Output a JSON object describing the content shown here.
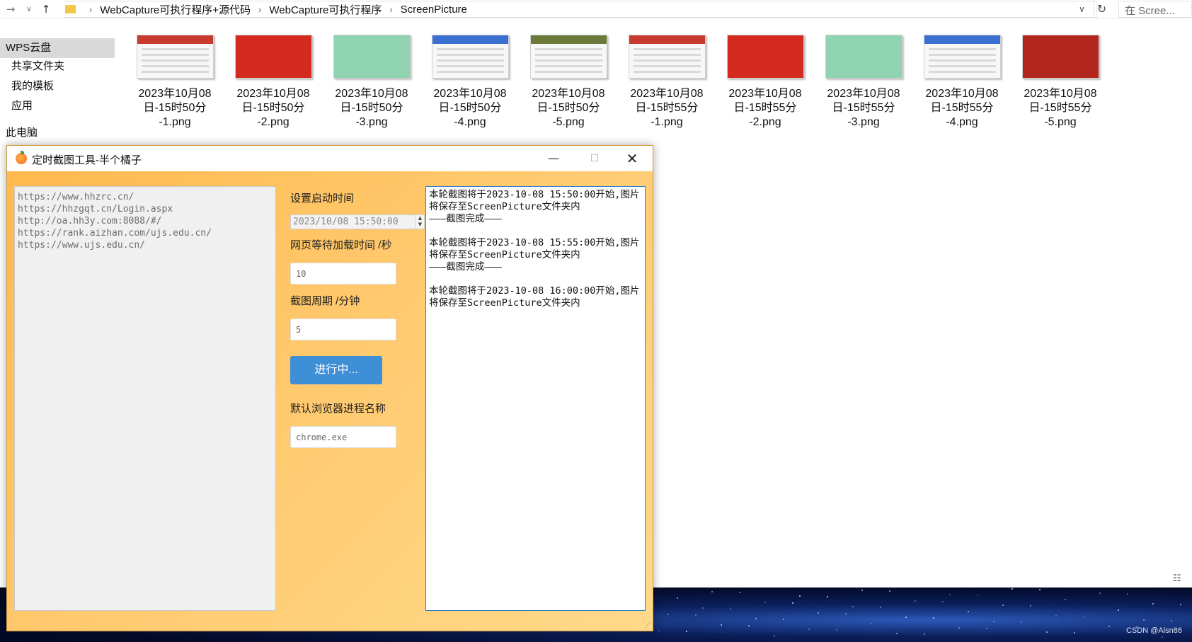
{
  "explorer": {
    "breadcrumbs": [
      "WebCapture可执行程序+源代码",
      "WebCapture可执行程序",
      "ScreenPicture"
    ],
    "search_placeholder": "在 Scree...",
    "sidebar": [
      {
        "label": "WPS云盘",
        "selected": true
      },
      {
        "label": "共享文件夹",
        "selected": false
      },
      {
        "label": "我的模板",
        "selected": false
      },
      {
        "label": "应用",
        "selected": false
      },
      {
        "label": "此电脑",
        "selected": false
      }
    ],
    "files": [
      {
        "line1": "2023年10月08",
        "line2": "日-15时50分",
        "line3": "-1.png",
        "accent": "#c83a2e"
      },
      {
        "line1": "2023年10月08",
        "line2": "日-15时50分",
        "line3": "-2.png",
        "accent": "#d42a1f"
      },
      {
        "line1": "2023年10月08",
        "line2": "日-15时50分",
        "line3": "-3.png",
        "accent": "#8fd3b0"
      },
      {
        "line1": "2023年10月08",
        "line2": "日-15时50分",
        "line3": "-4.png",
        "accent": "#3b6fd0"
      },
      {
        "line1": "2023年10月08",
        "line2": "日-15时50分",
        "line3": "-5.png",
        "accent": "#6b7a3a"
      },
      {
        "line1": "2023年10月08",
        "line2": "日-15时55分",
        "line3": "-1.png",
        "accent": "#c83a2e"
      },
      {
        "line1": "2023年10月08",
        "line2": "日-15时55分",
        "line3": "-2.png",
        "accent": "#d42a1f"
      },
      {
        "line1": "2023年10月08",
        "line2": "日-15时55分",
        "line3": "-3.png",
        "accent": "#8fd3b0"
      },
      {
        "line1": "2023年10月08",
        "line2": "日-15时55分",
        "line3": "-4.png",
        "accent": "#3b6fd0"
      },
      {
        "line1": "2023年10月08",
        "line2": "日-15时55分",
        "line3": "-5.png",
        "accent": "#b3261e"
      }
    ]
  },
  "app": {
    "title": "定时截图工具-半个橘子",
    "urls": "https://www.hhzrc.cn/\nhttps://hhzgqt.cn/Login.aspx\nhttp://oa.hh3y.com:8088/#/\nhttps://rank.aizhan.com/ujs.edu.cn/\nhttps://www.ujs.edu.cn/",
    "start_time_label": "设置启动时间",
    "start_time_value": "2023/10/08 15:50:00",
    "wait_label": "网页等待加载时间 /秒",
    "wait_value": "10",
    "period_label": "截图周期 /分钟",
    "period_value": "5",
    "run_button": "进行中...",
    "browser_label": "默认浏览器进程名称",
    "browser_value": "chrome.exe",
    "log": [
      {
        "text": "本轮截图将于2023-10-08 15:50:00开始,图片将保存至ScreenPicture文件夹内",
        "done": "———截图完成———"
      },
      {
        "text": "本轮截图将于2023-10-08 15:55:00开始,图片将保存至ScreenPicture文件夹内",
        "done": "———截图完成———"
      },
      {
        "text": "本轮截图将于2023-10-08 16:00:00开始,图片将保存至ScreenPicture文件夹内",
        "done": ""
      }
    ]
  },
  "watermark": "CSDN @Alsn86",
  "icons": {
    "back": "back-arrow-icon",
    "forward": "forward-arrow-icon",
    "up": "up-arrow-icon",
    "refresh": "refresh-icon",
    "minimize": "minimize-icon",
    "maximize": "maximize-icon",
    "close": "close-icon"
  }
}
